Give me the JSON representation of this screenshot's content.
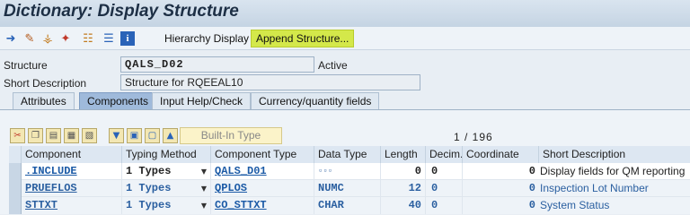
{
  "window": {
    "title": "Dictionary: Display Structure"
  },
  "toolbar": {
    "icons": [
      "arrow-right-icon",
      "glasses-pencil-icon",
      "lock-pencil-icon",
      "magic-wand-icon",
      "hierarchy-icon",
      "list-icon",
      "info-icon"
    ],
    "hierarchy_label": "Hierarchy Display",
    "append_label": "Append Structure..."
  },
  "header": {
    "structure_label": "Structure",
    "structure_value": "QALS_D02",
    "status": "Active",
    "short_desc_label": "Short Description",
    "short_desc_value": "Structure for RQEEAL10"
  },
  "tabs": [
    {
      "label": "Attributes"
    },
    {
      "label": "Components"
    },
    {
      "label": "Input Help/Check"
    },
    {
      "label": "Currency/quantity fields"
    }
  ],
  "grid_toolbar": {
    "builtin_label": "Built-In Type",
    "counter": "1 / 196"
  },
  "columns": [
    "Component",
    "Typing Method",
    "Component Type",
    "Data Type",
    "Length",
    "Decim...",
    "Coordinate",
    "Short Description"
  ],
  "rows": [
    {
      "component": ".INCLUDE",
      "typing": "1 Types",
      "ctype": "QALS_D01",
      "dtype": "▫▫▫",
      "length": "0",
      "decimals": "0",
      "coordinate": "0",
      "desc": "Display fields for QM reporting"
    },
    {
      "component": "PRUEFLOS",
      "typing": "1 Types",
      "ctype": "QPLOS",
      "dtype": "NUMC",
      "length": "12",
      "decimals": "0",
      "coordinate": "0",
      "desc": "Inspection Lot Number"
    },
    {
      "component": "STTXT",
      "typing": "1 Types",
      "ctype": "CO_STTXT",
      "dtype": "CHAR",
      "length": "40",
      "decimals": "0",
      "coordinate": "0",
      "desc": "System Status"
    }
  ],
  "colors": {
    "highlight": "#d4e84a",
    "selected_tab": "#9fbadb",
    "link": "#1b5aa6"
  }
}
